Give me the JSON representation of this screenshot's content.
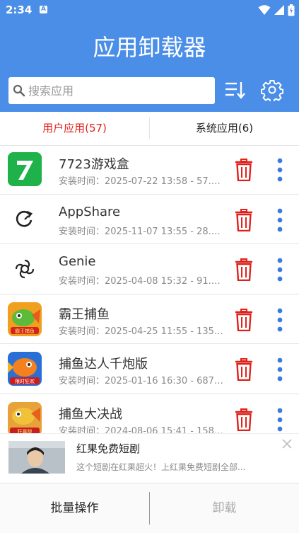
{
  "status_bar": {
    "time": "2:34",
    "notification": "A"
  },
  "header": {
    "title": "应用卸载器"
  },
  "search": {
    "placeholder": "搜索应用",
    "value": ""
  },
  "tabs": [
    {
      "label": "用户应用(57)",
      "active": true
    },
    {
      "label": "系统应用(6)",
      "active": false
    }
  ],
  "apps": [
    {
      "name": "7723游戏盒",
      "info": "安装时间：2025-07-22 13:58 - 57.62...",
      "icon": "7723-icon"
    },
    {
      "name": "AppShare",
      "info": "安装时间：2025-11-07 13:55 - 28.78...",
      "icon": "appshare-icon"
    },
    {
      "name": "Genie",
      "info": "安装时间：2025-04-08 15:32 - 91.94...",
      "icon": "genie-icon"
    },
    {
      "name": "霸王捕鱼",
      "info": "安装时间：2025-04-25 11:55 - 135.9...",
      "icon": "fish-game-icon"
    },
    {
      "name": "捕鱼达人千炮版",
      "info": "安装时间：2025-01-16 16:30 - 687.1...",
      "icon": "fish-game-icon"
    },
    {
      "name": "捕鱼大决战",
      "info": "安装时间：2024-08-06 15:41 - 158.5...",
      "icon": "fish-game-icon"
    }
  ],
  "ad": {
    "title": "红果免费短剧",
    "description": "这个短剧在红果超火！上红果免费短剧全部..."
  },
  "bottom": {
    "batch_label": "批量操作",
    "uninstall_label": "卸载"
  },
  "colors": {
    "primary": "#4a8ee8",
    "accent_red": "#e0201a",
    "more_blue": "#3a7be0"
  }
}
